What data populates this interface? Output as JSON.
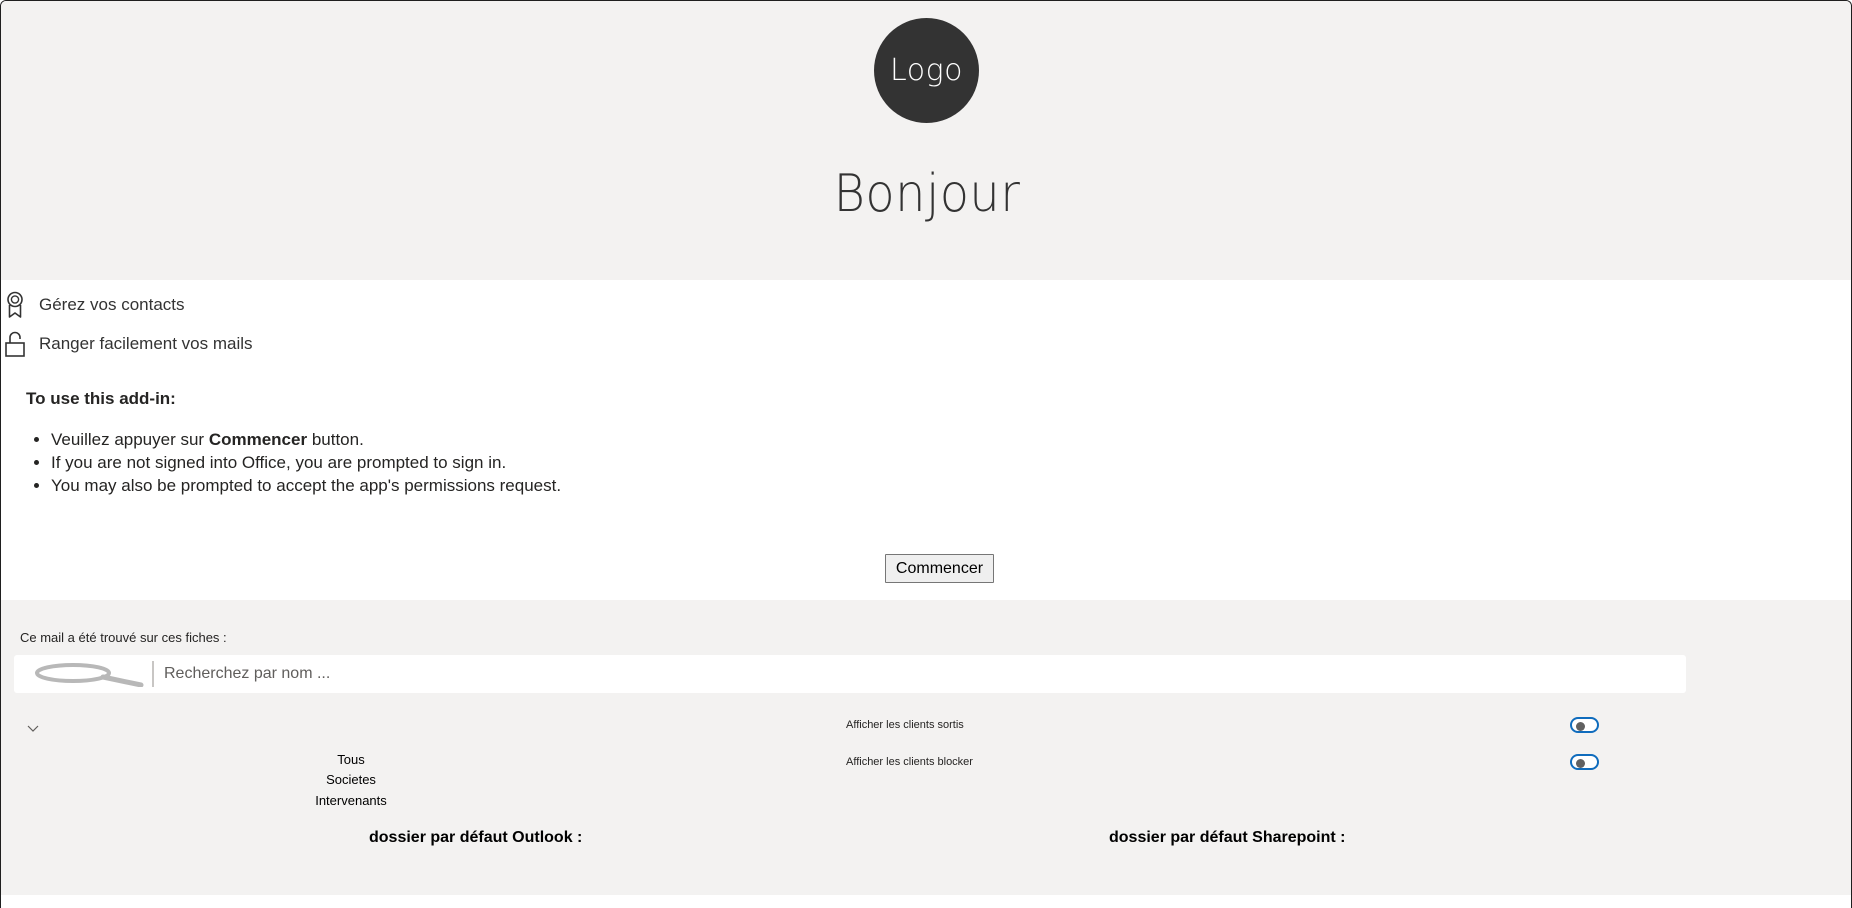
{
  "header": {
    "logo_text": "Logo",
    "welcome": "Bonjour",
    "background": "#f3f2f1"
  },
  "features": [
    {
      "icon": "ribbon-icon",
      "label": "Gérez vos contacts"
    },
    {
      "icon": "unlock-icon",
      "label": "Ranger facilement vos mails"
    }
  ],
  "instructions": {
    "title": "To use this add-in:",
    "item1_prefix": "Veuillez appuyer sur ",
    "item1_bold": "Commencer",
    "item1_suffix": " button.",
    "item2": "If you are not signed into Office, you are prompted to sign in.",
    "item3": "You may also be prompted to accept the app's permissions request."
  },
  "start_button": {
    "label": "Commencer"
  },
  "lower": {
    "found_label": "Ce mail a été trouvé sur ces fiches :",
    "search": {
      "icon": "search-icon",
      "placeholder": "Recherchez par nom ..."
    },
    "dropdown_icon": "chevron-down-icon",
    "filter_options": [
      "Tous",
      "Societes",
      "Intervenants"
    ],
    "toggles": [
      {
        "label": "Afficher les clients sortis",
        "on": false
      },
      {
        "label": "Afficher les clients blocker",
        "on": false
      }
    ],
    "outlook_folder_label": "dossier par défaut Outlook :",
    "sharepoint_folder_label": "dossier par défaut Sharepoint :"
  },
  "colors": {
    "accent": "#0f6cbd",
    "logo_bg": "#333333",
    "panel_bg": "#f3f2f1"
  }
}
